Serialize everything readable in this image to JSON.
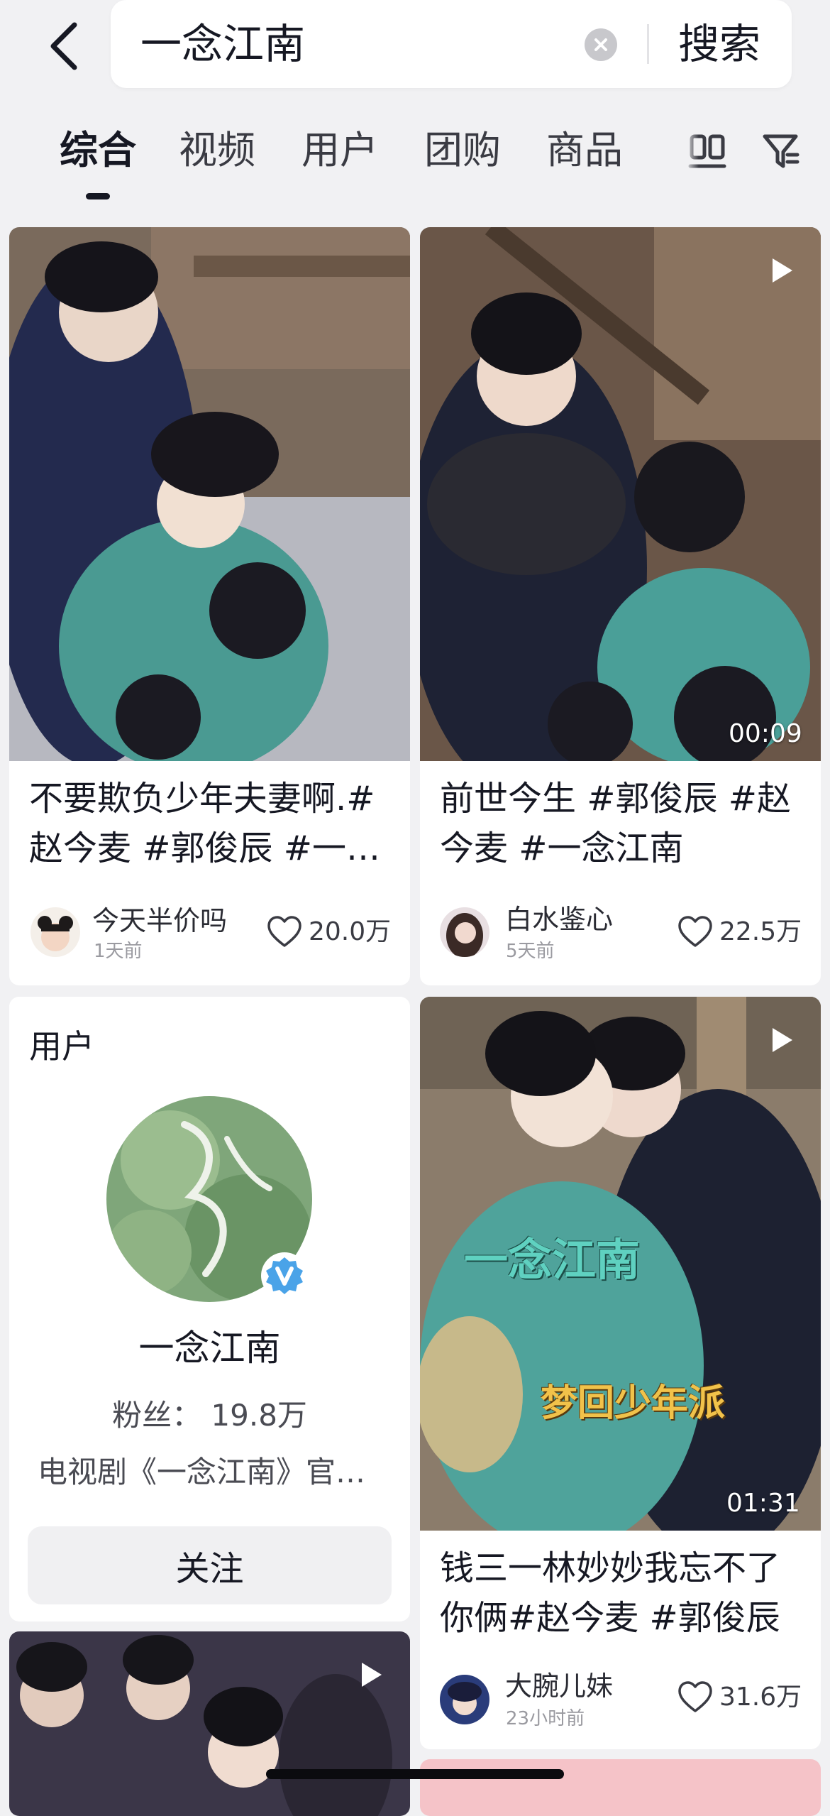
{
  "search": {
    "query": "一念江南",
    "submit_label": "搜索"
  },
  "tabs": [
    {
      "label": "综合",
      "active": true
    },
    {
      "label": "视频"
    },
    {
      "label": "用户"
    },
    {
      "label": "团购"
    },
    {
      "label": "商品"
    }
  ],
  "icons": {
    "back": "chevron-left-icon",
    "clear": "clear-icon",
    "layout": "layout-toggle-icon",
    "filter": "filter-icon",
    "like": "heart-outline-icon",
    "play": "play-icon",
    "verified": "verified-v-icon"
  },
  "colors": {
    "background": "#f1f1f3",
    "text_primary": "#161823",
    "verified_blue": "#4aa3e8"
  },
  "feed": {
    "video_cards": [
      {
        "title": "不要欺负少年夫妻啊.#赵今麦 #郭俊辰 #一念江南",
        "author": "今天半价吗",
        "time": "1天前",
        "likes": "20.0万"
      },
      {
        "title": "前世今生 #郭俊辰 #赵今麦 #一念江南",
        "author": "白水鉴心",
        "time": "5天前",
        "likes": "22.5万",
        "duration": "00:09"
      },
      {
        "title": "钱三一林妙妙我忘不了你俩#赵今麦 #郭俊辰",
        "author": "大腕儿妹",
        "time": "23小时前",
        "likes": "31.6万",
        "duration": "01:31",
        "overlay_title": "一念江南",
        "overlay_subtitle": "梦回少年派"
      }
    ],
    "user_card": {
      "heading": "用户",
      "name": "一念江南",
      "fans": "粉丝： 19.8万",
      "description": "电视剧《一念江南》官方账号",
      "follow_label": "关注"
    }
  }
}
